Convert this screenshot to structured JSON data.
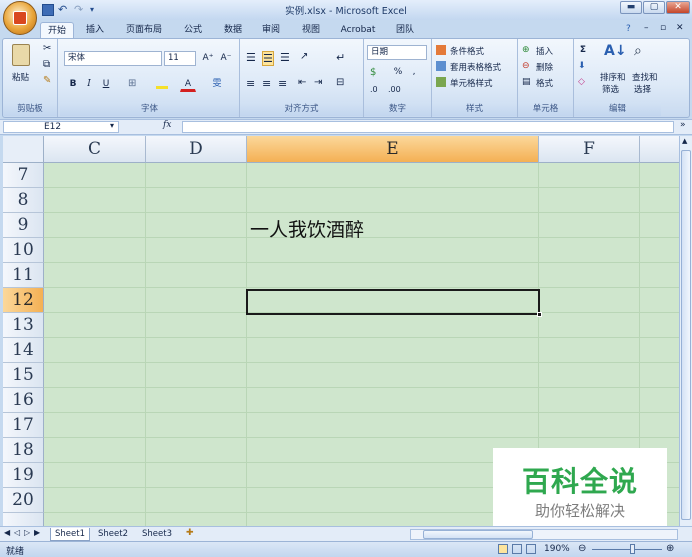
{
  "window": {
    "title": "实例.xlsx - Microsoft Excel",
    "min": "▬",
    "max": "▢",
    "close": "✕"
  },
  "ribbon_tabs": [
    "开始",
    "插入",
    "页面布局",
    "公式",
    "数据",
    "审阅",
    "视图",
    "Acrobat",
    "团队"
  ],
  "ribbon": {
    "clipboard": {
      "label": "剪贴板",
      "paste": "粘贴"
    },
    "font": {
      "label": "字体",
      "name": "宋体",
      "size": "11",
      "bold": "B",
      "italic": "I",
      "underline": "U",
      "grow": "A⁺",
      "shrink": "A⁻",
      "color_letter": "A",
      "phonetic": "雯"
    },
    "alignment": {
      "label": "对齐方式"
    },
    "number": {
      "label": "数字",
      "format": "日期",
      "percent": "%",
      "comma": ","
    },
    "styles": {
      "label": "样式",
      "conditional": "条件格式",
      "table": "套用表格格式",
      "cell_styles": "单元格样式"
    },
    "cells": {
      "label": "单元格",
      "insert": "插入",
      "delete": "删除",
      "format": "格式"
    },
    "editing": {
      "label": "编辑",
      "sum": "Σ",
      "sort": "排序和",
      "sort2": "筛选",
      "find": "查找和",
      "find2": "选择"
    }
  },
  "formula_bar": {
    "name_box": "E12",
    "fx": "fx",
    "content": ""
  },
  "columns": [
    "C",
    "D",
    "E",
    "F"
  ],
  "selected_column": "E",
  "rows": [
    "7",
    "8",
    "9",
    "10",
    "11",
    "12",
    "13",
    "14",
    "15",
    "16",
    "17",
    "18",
    "19",
    "20"
  ],
  "selected_row": "12",
  "cells": {
    "E9": "一人我饮酒醉"
  },
  "sheet_tabs": [
    "Sheet1",
    "Sheet2",
    "Sheet3"
  ],
  "status": {
    "mode": "就绪",
    "zoom": "190%"
  },
  "watermark": {
    "title": "百科全说",
    "subtitle": "助你轻松解决"
  },
  "colors": {
    "grid_bg": "#cfe6cd",
    "selected_header": "#f4b054",
    "ribbon": "#dde9f7",
    "watermark_green": "#2fa84f"
  }
}
